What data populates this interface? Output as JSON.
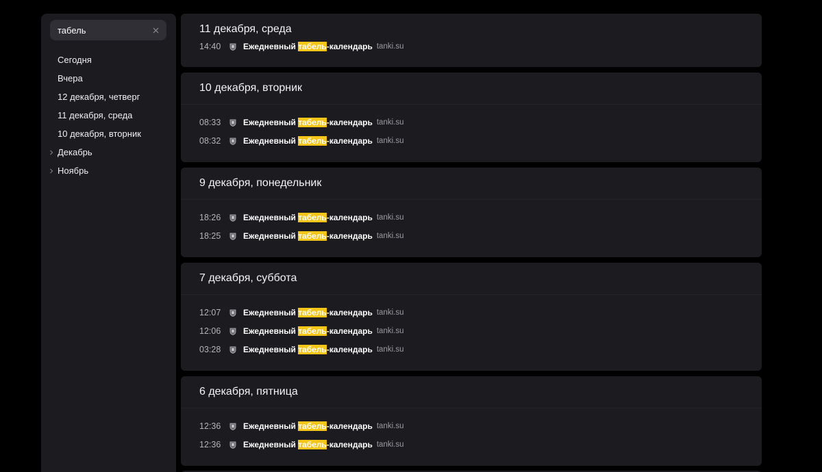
{
  "search": {
    "value": "табель",
    "placeholder": ""
  },
  "sidebar": {
    "items": [
      {
        "label": "Сегодня",
        "expandable": false
      },
      {
        "label": "Вчера",
        "expandable": false
      },
      {
        "label": "12 декабря, четверг",
        "expandable": false
      },
      {
        "label": "11 декабря, среда",
        "expandable": false
      },
      {
        "label": "10 декабря, вторник",
        "expandable": false
      },
      {
        "label": "Декабрь",
        "expandable": true
      },
      {
        "label": "Ноябрь",
        "expandable": true
      }
    ]
  },
  "entry_title": {
    "before": "Ежедневный ",
    "highlight": "табель",
    "after": "-календарь"
  },
  "days": [
    {
      "title": "11 декабря, среда",
      "entries": [
        {
          "time": "14:40",
          "domain": "tanki.su"
        }
      ]
    },
    {
      "title": "10 декабря, вторник",
      "entries": [
        {
          "time": "08:33",
          "domain": "tanki.su"
        },
        {
          "time": "08:32",
          "domain": "tanki.su"
        }
      ]
    },
    {
      "title": "9 декабря, понедельник",
      "entries": [
        {
          "time": "18:26",
          "domain": "tanki.su"
        },
        {
          "time": "18:25",
          "domain": "tanki.su"
        }
      ]
    },
    {
      "title": "7 декабря, суббота",
      "entries": [
        {
          "time": "12:07",
          "domain": "tanki.su"
        },
        {
          "time": "12:06",
          "domain": "tanki.su"
        },
        {
          "time": "03:28",
          "domain": "tanki.su"
        }
      ]
    },
    {
      "title": "6 декабря, пятница",
      "entries": [
        {
          "time": "12:36",
          "domain": "tanki.su"
        },
        {
          "time": "12:36",
          "domain": "tanki.su"
        }
      ]
    }
  ],
  "colors": {
    "background": "#000000",
    "panel": "#1c1c20",
    "search_field": "#2f2f35",
    "highlight": "#f5c518"
  },
  "icons": {
    "clear": "close-icon",
    "expand": "chevron-right-icon",
    "favicon": "tanki-favicon-icon"
  }
}
